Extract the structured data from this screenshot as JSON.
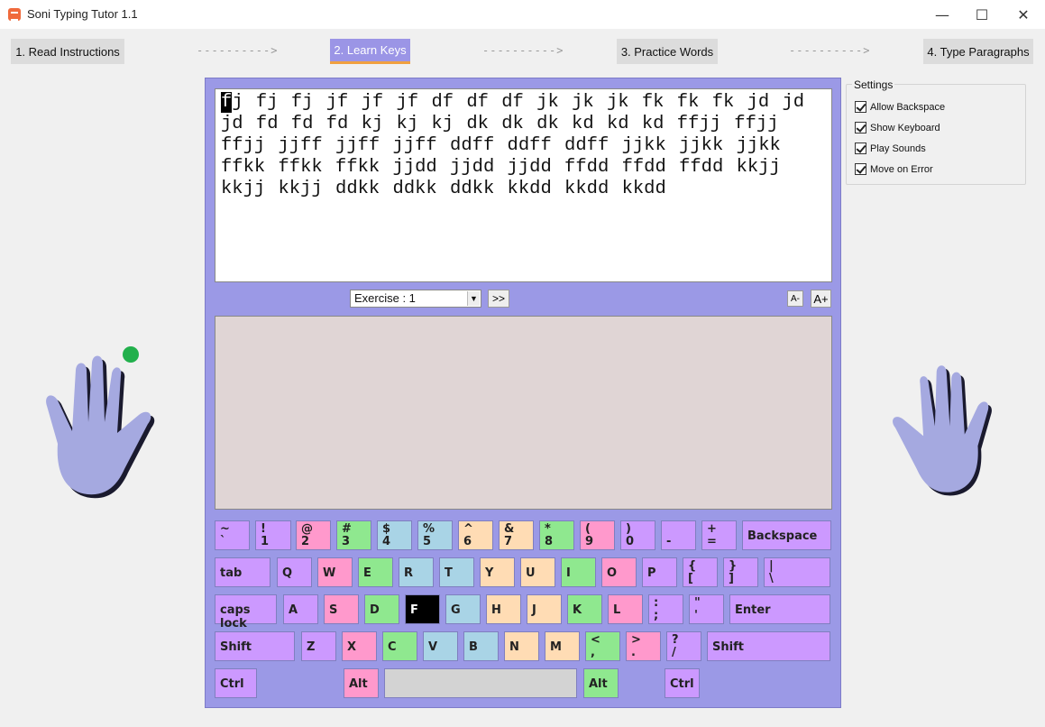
{
  "window": {
    "title": "Soni Typing Tutor 1.1",
    "minimize": "—",
    "maximize": "☐",
    "close": "✕"
  },
  "steps": [
    {
      "label": "1. Read Instructions"
    },
    {
      "label": "2. Learn Keys"
    },
    {
      "label": "3. Practice Words"
    },
    {
      "label": "4. Type Paragraphs"
    }
  ],
  "arrow_separator": "---------->",
  "exercise": {
    "cursor_char": "f",
    "text": "j fj fj jf jf jf df df df jk jk jk fk fk fk jd jd jd fd fd fd kj kj kj dk dk dk kd kd kd ffjj ffjj ffjj jjff jjff jjff ddff ddff ddff jjkk jjkk jjkk ffkk ffkk ffkk jjdd jjdd jjdd ffdd ffdd ffdd kkjj kkjj kkjj ddkk ddkk ddkk kkdd kkdd kkdd",
    "selector_value": "Exercise : 1",
    "next_label": ">>",
    "font_smaller": "A-",
    "font_larger": "A+"
  },
  "settings": {
    "title": "Settings",
    "options": [
      {
        "label": "Allow Backspace",
        "checked": true
      },
      {
        "label": "Show Keyboard",
        "checked": true
      },
      {
        "label": "Play Sounds",
        "checked": true
      },
      {
        "label": "Move on Error",
        "checked": true
      }
    ]
  },
  "colors": {
    "purple": "#cc99ff",
    "pink": "#ff99cc",
    "green": "#8fe88f",
    "blue": "#a9d4e6",
    "peach": "#ffdcb4",
    "highlight": "#000000",
    "space": "#d3d3d3",
    "hand": "#a5a9e0",
    "finger_dot": "#22b04c"
  },
  "keyboard": {
    "rows": [
      [
        {
          "top": "~",
          "bottom": "`",
          "color": "purple"
        },
        {
          "top": "!",
          "bottom": "1",
          "color": "purple"
        },
        {
          "top": "@",
          "bottom": "2",
          "color": "pink"
        },
        {
          "top": "#",
          "bottom": "3",
          "color": "green"
        },
        {
          "top": "$",
          "bottom": "4",
          "color": "blue"
        },
        {
          "top": "%",
          "bottom": "5",
          "color": "blue"
        },
        {
          "top": "^",
          "bottom": "6",
          "color": "peach"
        },
        {
          "top": "&",
          "bottom": "7",
          "color": "peach"
        },
        {
          "top": "*",
          "bottom": "8",
          "color": "green"
        },
        {
          "top": "(",
          "bottom": "9",
          "color": "pink"
        },
        {
          "top": ")",
          "bottom": "0",
          "color": "purple"
        },
        {
          "top": "",
          "bottom": "-",
          "color": "purple"
        },
        {
          "top": "+",
          "bottom": "=",
          "color": "purple"
        },
        {
          "label": "Backspace",
          "color": "purple"
        }
      ],
      [
        {
          "label": "tab",
          "color": "purple"
        },
        {
          "label": "Q",
          "color": "purple"
        },
        {
          "label": "W",
          "color": "pink"
        },
        {
          "label": "E",
          "color": "green"
        },
        {
          "label": "R",
          "color": "blue"
        },
        {
          "label": "T",
          "color": "blue"
        },
        {
          "label": "Y",
          "color": "peach"
        },
        {
          "label": "U",
          "color": "peach"
        },
        {
          "label": "I",
          "color": "green"
        },
        {
          "label": "O",
          "color": "pink"
        },
        {
          "label": "P",
          "color": "purple"
        },
        {
          "top": "{",
          "bottom": "[",
          "color": "purple"
        },
        {
          "top": "}",
          "bottom": "]",
          "color": "purple"
        },
        {
          "top": "|",
          "bottom": "\\",
          "color": "purple"
        }
      ],
      [
        {
          "label": "caps lock",
          "color": "purple"
        },
        {
          "label": "A",
          "color": "purple"
        },
        {
          "label": "S",
          "color": "pink"
        },
        {
          "label": "D",
          "color": "green"
        },
        {
          "label": "F",
          "color": "highlight"
        },
        {
          "label": "G",
          "color": "blue"
        },
        {
          "label": "H",
          "color": "peach"
        },
        {
          "label": "J",
          "color": "peach"
        },
        {
          "label": "K",
          "color": "green"
        },
        {
          "label": "L",
          "color": "pink"
        },
        {
          "top": ":",
          "bottom": ";",
          "color": "purple"
        },
        {
          "top": "\"",
          "bottom": "'",
          "color": "purple"
        },
        {
          "label": "Enter",
          "color": "purple"
        }
      ],
      [
        {
          "label": "Shift",
          "color": "purple"
        },
        {
          "label": "Z",
          "color": "purple"
        },
        {
          "label": "X",
          "color": "pink"
        },
        {
          "label": "C",
          "color": "green"
        },
        {
          "label": "V",
          "color": "blue"
        },
        {
          "label": "B",
          "color": "blue"
        },
        {
          "label": "N",
          "color": "peach"
        },
        {
          "label": "M",
          "color": "peach"
        },
        {
          "top": "<",
          "bottom": ",",
          "color": "green"
        },
        {
          "top": ">",
          "bottom": ".",
          "color": "pink"
        },
        {
          "top": "?",
          "bottom": "/",
          "color": "purple"
        },
        {
          "label": "Shift",
          "color": "purple"
        }
      ],
      [
        {
          "label": "Ctrl",
          "color": "purple"
        },
        {
          "label": "Alt",
          "color": "pink"
        },
        {
          "label": "",
          "color": "space"
        },
        {
          "label": "Alt",
          "color": "green"
        },
        {
          "label": "Ctrl",
          "color": "purple"
        }
      ]
    ]
  }
}
